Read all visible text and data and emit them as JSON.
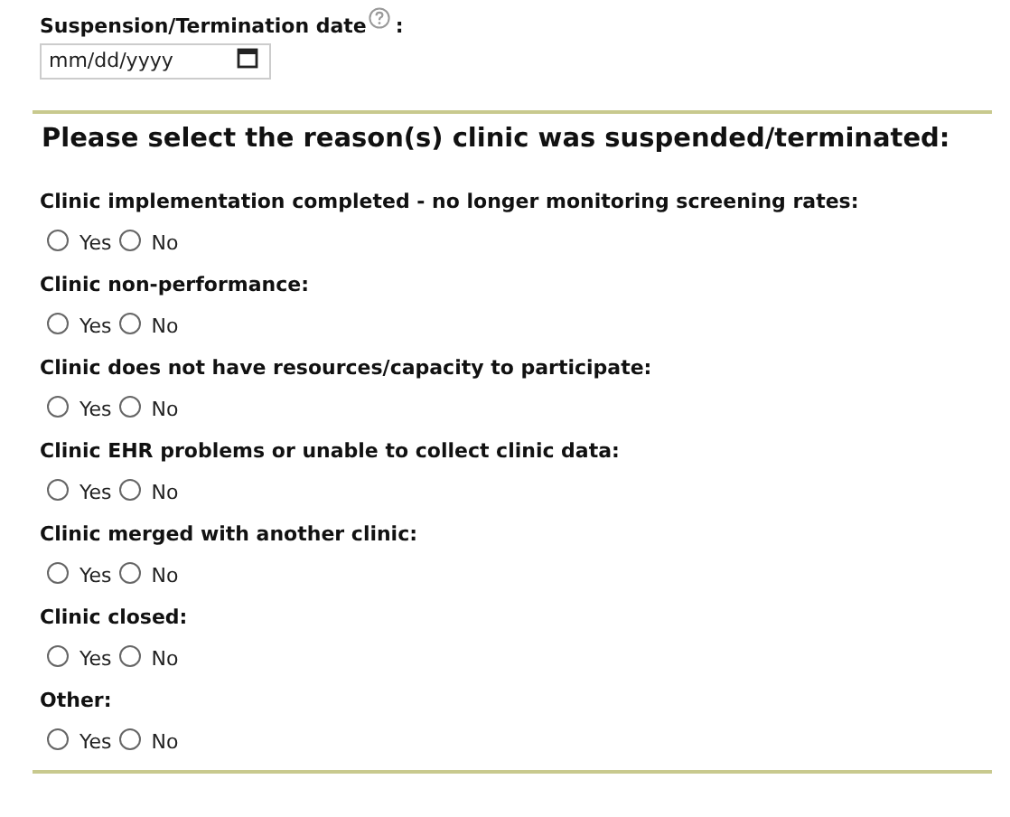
{
  "date_field": {
    "label": "Suspension/Termination date",
    "colon": ":",
    "placeholder": "mm/dd/yyyy"
  },
  "heading": "Please select the reason(s) clinic was suspended/terminated:",
  "questions": [
    {
      "label": "Clinic implementation completed - no longer monitoring screening rates:",
      "options": [
        {
          "label": "Yes",
          "selected": false
        },
        {
          "label": "No",
          "selected": false
        }
      ]
    },
    {
      "label": "Clinic non-performance:",
      "options": [
        {
          "label": "Yes",
          "selected": false
        },
        {
          "label": "No",
          "selected": false
        }
      ]
    },
    {
      "label": "Clinic does not have resources/capacity to participate:",
      "options": [
        {
          "label": "Yes",
          "selected": false
        },
        {
          "label": "No",
          "selected": false
        }
      ]
    },
    {
      "label": "Clinic EHR problems or unable to collect clinic data:",
      "options": [
        {
          "label": "Yes",
          "selected": false
        },
        {
          "label": "No",
          "selected": false
        }
      ]
    },
    {
      "label": "Clinic merged with another clinic:",
      "options": [
        {
          "label": "Yes",
          "selected": false
        },
        {
          "label": "No",
          "selected": false
        }
      ]
    },
    {
      "label": "Clinic closed:",
      "options": [
        {
          "label": "Yes",
          "selected": false
        },
        {
          "label": "No",
          "selected": false
        }
      ]
    },
    {
      "label": "Other:",
      "options": [
        {
          "label": "Yes",
          "selected": false
        },
        {
          "label": "No",
          "selected": false
        }
      ]
    }
  ]
}
